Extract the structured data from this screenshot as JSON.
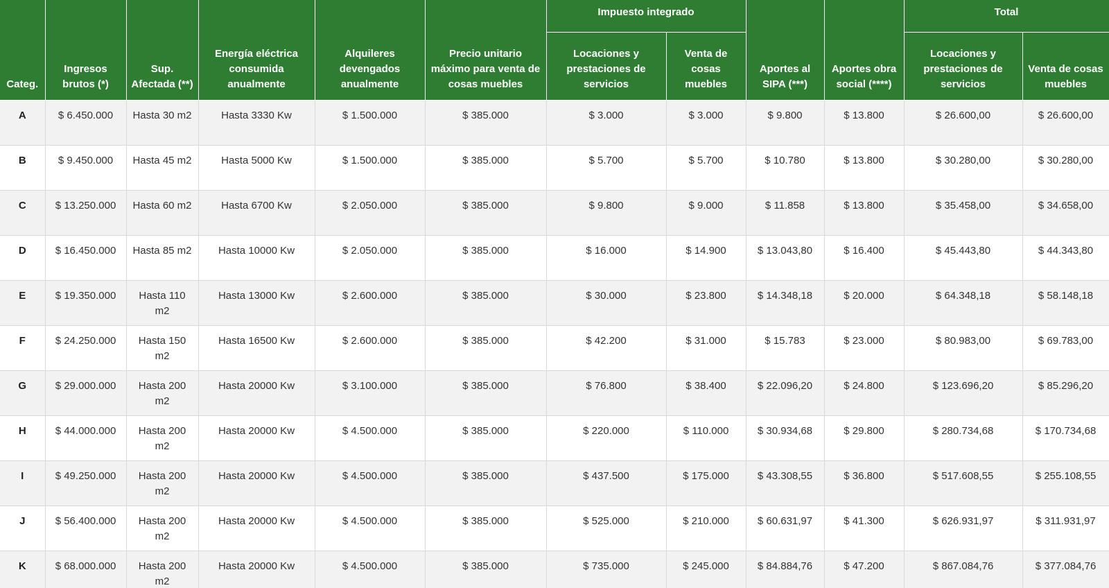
{
  "headers": {
    "categ": "Categ.",
    "ingresos": "Ingresos brutos (*)",
    "sup": "Sup. Afectada (**)",
    "energia": "Energía eléctrica consumida anualmente",
    "alquileres": "Alquileres devengados anualmente",
    "precio": "Precio unitario máximo para venta de cosas muebles",
    "impuesto_group": "Impuesto integrado",
    "impuesto_loc": "Locaciones y prestaciones de servicios",
    "impuesto_venta": "Venta de cosas muebles",
    "sipa": "Aportes al SIPA (***)",
    "obra": "Aportes obra social (****)",
    "total_group": "Total",
    "total_loc": "Locaciones y prestaciones de servicios",
    "total_venta": "Venta de cosas muebles"
  },
  "rows": [
    {
      "cat": "A",
      "ingresos": "$ 6.450.000",
      "sup": "Hasta 30 m2",
      "energia": "Hasta 3330 Kw",
      "alquileres": "$ 1.500.000",
      "precio": "$ 385.000",
      "imp_loc": "$ 3.000",
      "imp_venta": "$ 3.000",
      "sipa": "$ 9.800",
      "obra": "$ 13.800",
      "tot_loc": "$ 26.600,00",
      "tot_venta": "$ 26.600,00"
    },
    {
      "cat": "B",
      "ingresos": "$ 9.450.000",
      "sup": "Hasta 45 m2",
      "energia": "Hasta 5000 Kw",
      "alquileres": "$ 1.500.000",
      "precio": "$ 385.000",
      "imp_loc": "$ 5.700",
      "imp_venta": "$ 5.700",
      "sipa": "$ 10.780",
      "obra": "$ 13.800",
      "tot_loc": "$ 30.280,00",
      "tot_venta": "$ 30.280,00"
    },
    {
      "cat": "C",
      "ingresos": "$ 13.250.000",
      "sup": "Hasta 60 m2",
      "energia": "Hasta 6700 Kw",
      "alquileres": "$ 2.050.000",
      "precio": "$ 385.000",
      "imp_loc": "$ 9.800",
      "imp_venta": "$ 9.000",
      "sipa": "$ 11.858",
      "obra": "$ 13.800",
      "tot_loc": "$ 35.458,00",
      "tot_venta": "$ 34.658,00"
    },
    {
      "cat": "D",
      "ingresos": "$ 16.450.000",
      "sup": "Hasta 85 m2",
      "energia": "Hasta 10000 Kw",
      "alquileres": "$ 2.050.000",
      "precio": "$ 385.000",
      "imp_loc": "$ 16.000",
      "imp_venta": "$ 14.900",
      "sipa": "$ 13.043,80",
      "obra": "$ 16.400",
      "tot_loc": "$ 45.443,80",
      "tot_venta": "$ 44.343,80"
    },
    {
      "cat": "E",
      "ingresos": "$ 19.350.000",
      "sup": "Hasta 110 m2",
      "energia": "Hasta 13000 Kw",
      "alquileres": "$ 2.600.000",
      "precio": "$ 385.000",
      "imp_loc": "$ 30.000",
      "imp_venta": "$ 23.800",
      "sipa": "$ 14.348,18",
      "obra": "$ 20.000",
      "tot_loc": "$ 64.348,18",
      "tot_venta": "$ 58.148,18"
    },
    {
      "cat": "F",
      "ingresos": "$ 24.250.000",
      "sup": "Hasta 150 m2",
      "energia": "Hasta 16500 Kw",
      "alquileres": "$ 2.600.000",
      "precio": "$ 385.000",
      "imp_loc": "$ 42.200",
      "imp_venta": "$ 31.000",
      "sipa": "$ 15.783",
      "obra": "$ 23.000",
      "tot_loc": "$ 80.983,00",
      "tot_venta": "$ 69.783,00"
    },
    {
      "cat": "G",
      "ingresos": "$ 29.000.000",
      "sup": "Hasta 200 m2",
      "energia": "Hasta 20000 Kw",
      "alquileres": "$ 3.100.000",
      "precio": "$ 385.000",
      "imp_loc": "$ 76.800",
      "imp_venta": "$ 38.400",
      "sipa": "$ 22.096,20",
      "obra": "$ 24.800",
      "tot_loc": "$ 123.696,20",
      "tot_venta": "$ 85.296,20"
    },
    {
      "cat": "H",
      "ingresos": "$ 44.000.000",
      "sup": "Hasta 200 m2",
      "energia": "Hasta 20000 Kw",
      "alquileres": "$ 4.500.000",
      "precio": "$ 385.000",
      "imp_loc": "$ 220.000",
      "imp_venta": "$ 110.000",
      "sipa": "$ 30.934,68",
      "obra": "$ 29.800",
      "tot_loc": "$ 280.734,68",
      "tot_venta": "$ 170.734,68"
    },
    {
      "cat": "I",
      "ingresos": "$ 49.250.000",
      "sup": "Hasta 200 m2",
      "energia": "Hasta 20000 Kw",
      "alquileres": "$ 4.500.000",
      "precio": "$ 385.000",
      "imp_loc": "$ 437.500",
      "imp_venta": "$ 175.000",
      "sipa": "$ 43.308,55",
      "obra": "$ 36.800",
      "tot_loc": "$ 517.608,55",
      "tot_venta": "$ 255.108,55"
    },
    {
      "cat": "J",
      "ingresos": "$ 56.400.000",
      "sup": "Hasta 200 m2",
      "energia": "Hasta 20000 Kw",
      "alquileres": "$ 4.500.000",
      "precio": "$ 385.000",
      "imp_loc": "$ 525.000",
      "imp_venta": "$ 210.000",
      "sipa": "$ 60.631,97",
      "obra": "$ 41.300",
      "tot_loc": "$ 626.931,97",
      "tot_venta": "$ 311.931,97"
    },
    {
      "cat": "K",
      "ingresos": "$ 68.000.000",
      "sup": "Hasta 200 m2",
      "energia": "Hasta 20000 Kw",
      "alquileres": "$ 4.500.000",
      "precio": "$ 385.000",
      "imp_loc": "$ 735.000",
      "imp_venta": "$ 245.000",
      "sipa": "$ 84.884,76",
      "obra": "$ 47.200",
      "tot_loc": "$ 867.084,76",
      "tot_venta": "$ 377.084,76"
    }
  ]
}
